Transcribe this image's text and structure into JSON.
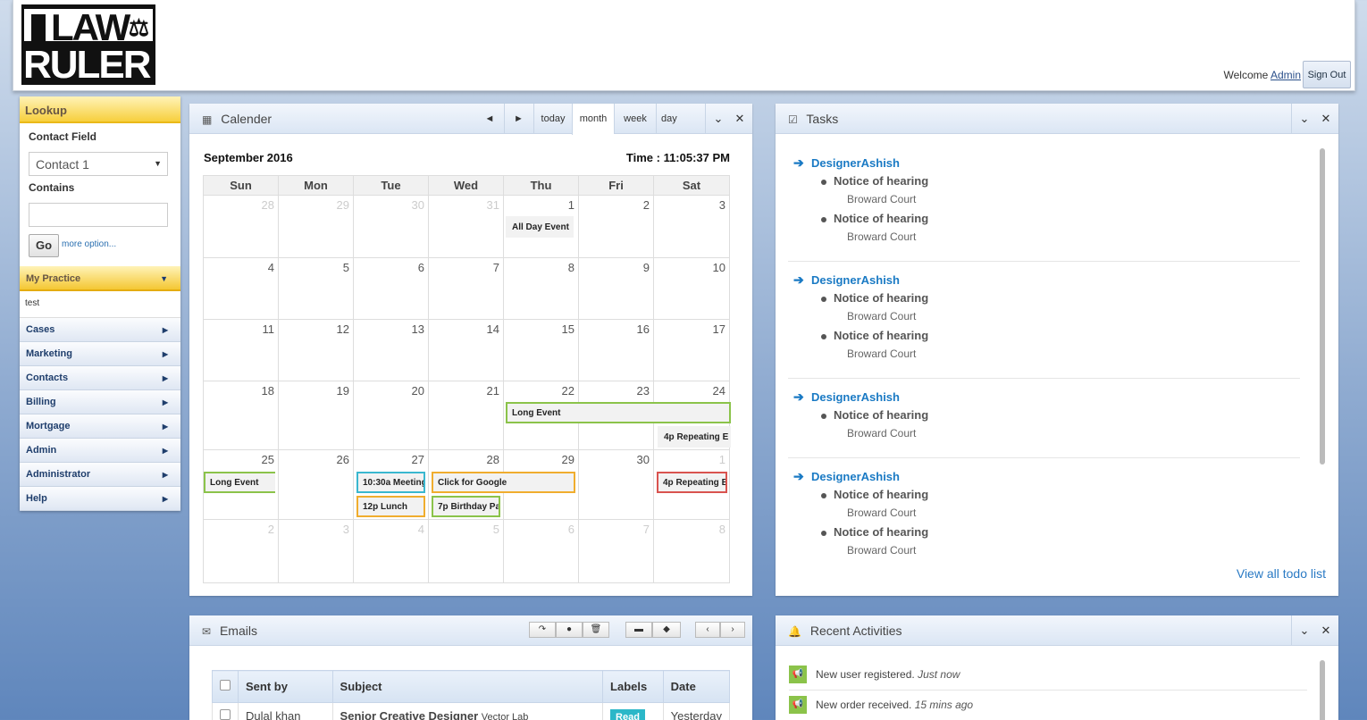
{
  "header": {
    "logo_line1": "LAW",
    "logo_line2": "RULER",
    "welcome_text": "Welcome",
    "user_name": "Admin",
    "sign_out": "Sign Out"
  },
  "sidebar": {
    "lookup_title": "Lookup",
    "contact_field_label": "Contact Field",
    "contact_field_value": "Contact 1",
    "contains_label": "Contains",
    "contains_value": "",
    "go_label": "Go",
    "more_options": "more option...",
    "practice_title": "My Practice",
    "practice_item": "test",
    "nav": [
      "Cases",
      "Marketing",
      "Contacts",
      "Billing",
      "Mortgage",
      "Admin",
      "Administrator",
      "Help"
    ]
  },
  "calendar": {
    "title": "Calender",
    "buttons": {
      "prev": "◄",
      "next": "►",
      "today": "today",
      "month": "month",
      "week": "week",
      "day": "day"
    },
    "month_label": "September 2016",
    "time_label": "Time : 11:05:37 PM",
    "days": [
      "Sun",
      "Mon",
      "Tue",
      "Wed",
      "Thu",
      "Fri",
      "Sat"
    ],
    "weeks": [
      [
        "28",
        "29",
        "30",
        "31",
        "1",
        "2",
        "3"
      ],
      [
        "4",
        "5",
        "6",
        "7",
        "8",
        "9",
        "10"
      ],
      [
        "11",
        "12",
        "13",
        "14",
        "15",
        "16",
        "17"
      ],
      [
        "18",
        "19",
        "20",
        "21",
        "22",
        "23",
        "24"
      ],
      [
        "25",
        "26",
        "27",
        "28",
        "29",
        "30",
        "1"
      ],
      [
        "2",
        "3",
        "4",
        "5",
        "6",
        "7",
        "8"
      ]
    ],
    "events": {
      "all_day": "All Day Event",
      "long_event_1": "Long Event",
      "repeating_1": "4p Repeating E",
      "long_event_2": "Long Event",
      "meeting": "10:30a Meeting",
      "google": "Click for Google",
      "repeating_2": "4p Repeating E",
      "lunch": "12p Lunch",
      "birthday": "7p Birthday Pa"
    },
    "event_colors": {
      "green": "#8bc34a",
      "cyan": "#3ab7cf",
      "orange": "#f0ad2e",
      "red": "#d9534f"
    }
  },
  "tasks": {
    "title": "Tasks",
    "groups": [
      {
        "user": "DesignerAshish",
        "items": [
          {
            "title": "Notice of hearing",
            "sub": "Broward Court"
          },
          {
            "title": "Notice of hearing",
            "sub": "Broward Court"
          }
        ]
      },
      {
        "user": "DesignerAshish",
        "items": [
          {
            "title": "Notice of hearing",
            "sub": "Broward Court"
          },
          {
            "title": "Notice of hearing",
            "sub": "Broward Court"
          }
        ]
      },
      {
        "user": "DesignerAshish",
        "items": [
          {
            "title": "Notice of hearing",
            "sub": "Broward Court"
          }
        ]
      },
      {
        "user": "DesignerAshish",
        "items": [
          {
            "title": "Notice of hearing",
            "sub": "Broward Court"
          },
          {
            "title": "Notice of hearing",
            "sub": "Broward Court"
          }
        ]
      }
    ],
    "view_all": "View all todo list"
  },
  "emails": {
    "title": "Emails",
    "columns": [
      "Sent by",
      "Subject",
      "Labels",
      "Date"
    ],
    "rows": [
      {
        "sender": "Dulal khan",
        "subject": "Senior Creative Designer",
        "subject_extra": "Vector Lab",
        "label": "Read",
        "date": "Yesterday"
      }
    ]
  },
  "activity": {
    "title": "Recent Activities",
    "items": [
      {
        "text": "New user registered.",
        "time": "Just now"
      },
      {
        "text": "New order received.",
        "time": "15 mins ago"
      }
    ]
  }
}
